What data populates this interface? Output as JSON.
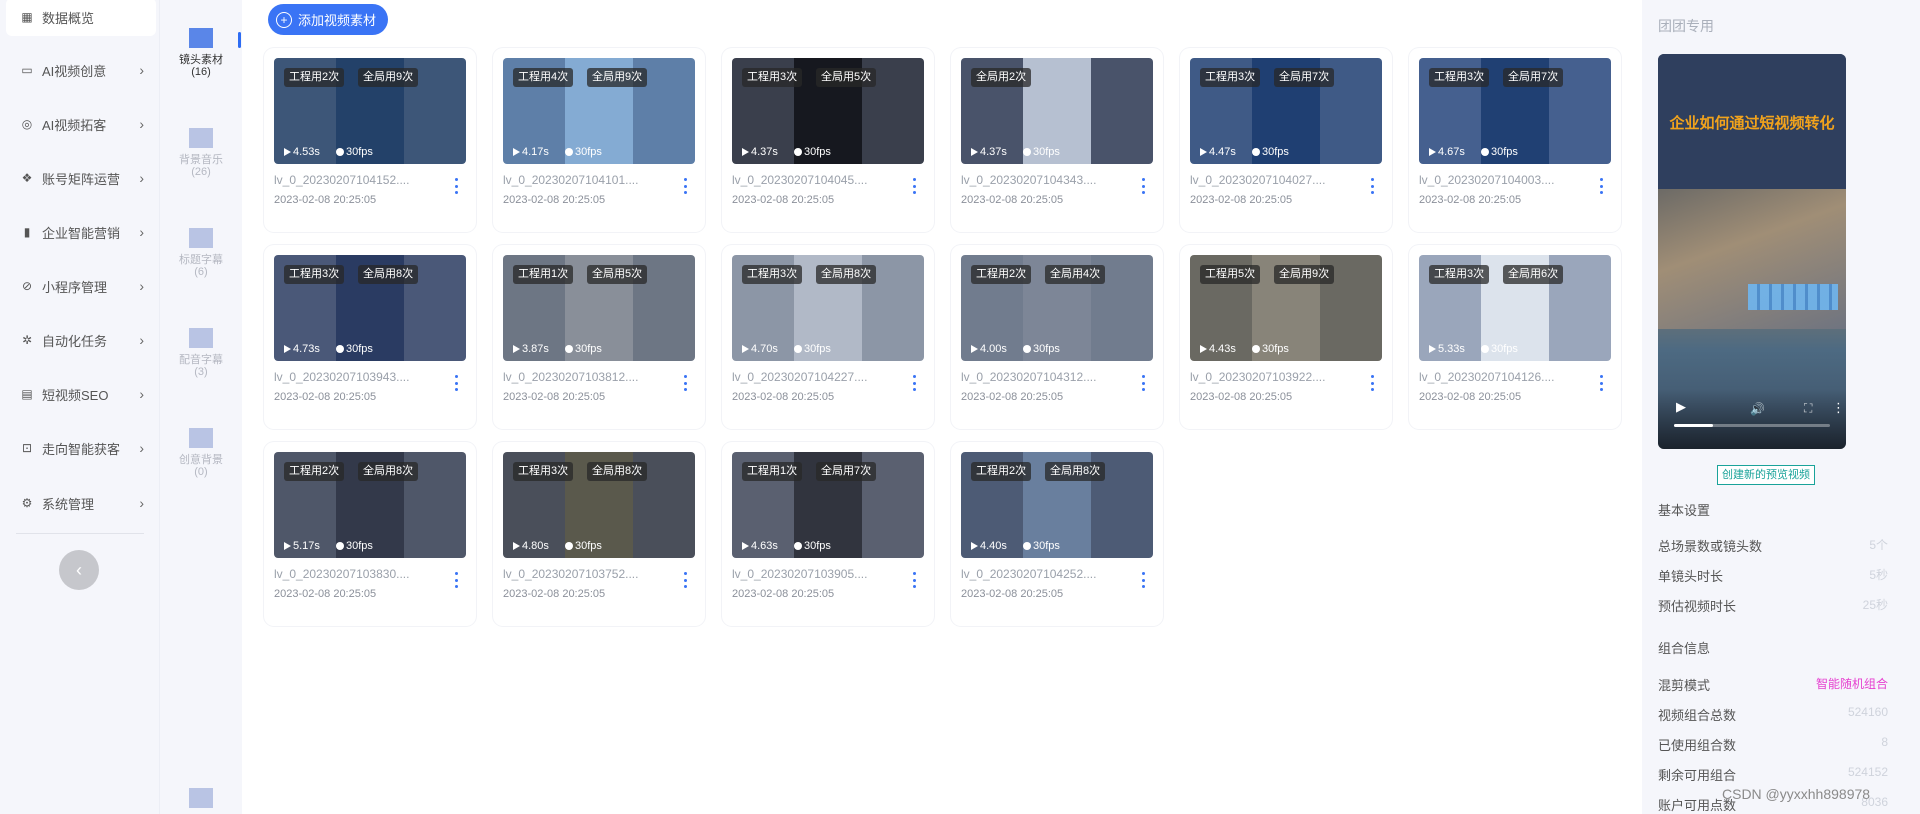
{
  "nav": {
    "items": [
      {
        "label": "数据概览",
        "icon": "dashboard-icon",
        "glyph": "▦",
        "arrow": ""
      },
      {
        "label": "AI视频创意",
        "icon": "image-icon",
        "glyph": "▭",
        "arrow": "›"
      },
      {
        "label": "AI视频拓客",
        "icon": "globe-icon",
        "glyph": "◎",
        "arrow": "›"
      },
      {
        "label": "账号矩阵运营",
        "icon": "matrix-icon",
        "glyph": "❖",
        "arrow": "›"
      },
      {
        "label": "企业智能营销",
        "icon": "bar-chart-icon",
        "glyph": "▮",
        "arrow": "›"
      },
      {
        "label": "小程序管理",
        "icon": "compass-icon",
        "glyph": "⊘",
        "arrow": "›"
      },
      {
        "label": "自动化任务",
        "icon": "cog-task-icon",
        "glyph": "✲",
        "arrow": "›"
      },
      {
        "label": "短视频SEO",
        "icon": "list-icon",
        "glyph": "▤",
        "arrow": "›"
      },
      {
        "label": "走向智能获客",
        "icon": "gift-icon",
        "glyph": "⊡",
        "arrow": "›"
      },
      {
        "label": "系统管理",
        "icon": "gear-icon",
        "glyph": "⚙",
        "arrow": "›"
      }
    ],
    "collapse_glyph": "‹"
  },
  "categories": [
    {
      "label": "镜头素材",
      "count": "(16)"
    },
    {
      "label": "背景音乐",
      "count": "(26)"
    },
    {
      "label": "标题字幕",
      "count": "(6)"
    },
    {
      "label": "配音字幕",
      "count": "(3)"
    },
    {
      "label": "创意背景",
      "count": "(0)"
    },
    {
      "label": "",
      "count": ""
    }
  ],
  "toolbar": {
    "add_label": "添加视频素材",
    "add_glyph": "+"
  },
  "videos": [
    {
      "engineer": "工程用2次",
      "global": "全局用9次",
      "duration": "4.53s",
      "fps": "30fps",
      "name": "lv_0_20230207104152....",
      "date": "2023-02-08 20:25:05",
      "bg": "#3d5678",
      "shot": "#1f3d66"
    },
    {
      "engineer": "工程用4次",
      "global": "全局用9次",
      "duration": "4.17s",
      "fps": "30fps",
      "name": "lv_0_20230207104101....",
      "date": "2023-02-08 20:25:05",
      "bg": "#5e7fa8",
      "shot": "#8bb3db"
    },
    {
      "engineer": "工程用3次",
      "global": "全局用5次",
      "duration": "4.37s",
      "fps": "30fps",
      "name": "lv_0_20230207104045....",
      "date": "2023-02-08 20:25:05",
      "bg": "#3a3f4c",
      "shot": "#111217"
    },
    {
      "engineer": "",
      "global": "全局用2次",
      "duration": "4.37s",
      "fps": "30fps",
      "name": "lv_0_20230207104343....",
      "date": "2023-02-08 20:25:05",
      "bg": "#49536a",
      "shot": "#c9d3e3"
    },
    {
      "engineer": "工程用3次",
      "global": "全局用7次",
      "duration": "4.47s",
      "fps": "30fps",
      "name": "lv_0_20230207104027....",
      "date": "2023-02-08 20:25:05",
      "bg": "#3f5a86",
      "shot": "#1a3b6e"
    },
    {
      "engineer": "工程用3次",
      "global": "全局用7次",
      "duration": "4.67s",
      "fps": "30fps",
      "name": "lv_0_20230207104003....",
      "date": "2023-02-08 20:25:05",
      "bg": "#45608f",
      "shot": "#1a3b6e"
    },
    {
      "engineer": "工程用3次",
      "global": "全局用8次",
      "duration": "4.73s",
      "fps": "30fps",
      "name": "lv_0_20230207103943....",
      "date": "2023-02-08 20:25:05",
      "bg": "#4a5878",
      "shot": "#24365e"
    },
    {
      "engineer": "工程用1次",
      "global": "全局用5次",
      "duration": "3.87s",
      "fps": "30fps",
      "name": "lv_0_20230207103812....",
      "date": "2023-02-08 20:25:05",
      "bg": "#6d7684",
      "shot": "#8e949c"
    },
    {
      "engineer": "工程用3次",
      "global": "全局用8次",
      "duration": "4.70s",
      "fps": "30fps",
      "name": "lv_0_20230207104227....",
      "date": "2023-02-08 20:25:05",
      "bg": "#8c96a6",
      "shot": "#b7c0cc"
    },
    {
      "engineer": "工程用2次",
      "global": "全局用4次",
      "duration": "4.00s",
      "fps": "30fps",
      "name": "lv_0_20230207104312....",
      "date": "2023-02-08 20:25:05",
      "bg": "#717c8e",
      "shot": "#7f8899"
    },
    {
      "engineer": "工程用5次",
      "global": "全局用9次",
      "duration": "4.43s",
      "fps": "30fps",
      "name": "lv_0_20230207103922....",
      "date": "2023-02-08 20:25:05",
      "bg": "#6a6962",
      "shot": "#8d8a7e"
    },
    {
      "engineer": "工程用3次",
      "global": "全局用6次",
      "duration": "5.33s",
      "fps": "30fps",
      "name": "lv_0_20230207104126....",
      "date": "2023-02-08 20:25:05",
      "bg": "#9aa6bb",
      "shot": "#e8edf4"
    },
    {
      "engineer": "工程用2次",
      "global": "全局用8次",
      "duration": "5.17s",
      "fps": "30fps",
      "name": "lv_0_20230207103830....",
      "date": "2023-02-08 20:25:05",
      "bg": "#4f5769",
      "shot": "#2e3445"
    },
    {
      "engineer": "工程用3次",
      "global": "全局用8次",
      "duration": "4.80s",
      "fps": "30fps",
      "name": "lv_0_20230207103752....",
      "date": "2023-02-08 20:25:05",
      "bg": "#4a4f5a",
      "shot": "#5d5a4a"
    },
    {
      "engineer": "工程用1次",
      "global": "全局用7次",
      "duration": "4.63s",
      "fps": "30fps",
      "name": "lv_0_20230207103905....",
      "date": "2023-02-08 20:25:05",
      "bg": "#5a6070",
      "shot": "#2a2d35"
    },
    {
      "engineer": "工程用2次",
      "global": "全局用8次",
      "duration": "4.40s",
      "fps": "30fps",
      "name": "lv_0_20230207104252....",
      "date": "2023-02-08 20:25:05",
      "bg": "#4d5b75",
      "shot": "#6e86a6"
    }
  ],
  "panel": {
    "title": "团团专用",
    "player": {
      "headline": "企业如何通过短视频转化",
      "play_glyph": "▶",
      "volume_glyph": "🔊",
      "fullscreen_glyph": "⛶",
      "more_glyph": "⋮",
      "progress": 0.25
    },
    "create_label": "创建新的预览视频",
    "basic_title": "基本设置",
    "basic": [
      {
        "label": "总场景数或镜头数",
        "value": "5个"
      },
      {
        "label": "单镜头时长",
        "value": "5秒"
      },
      {
        "label": "预估视频时长",
        "value": "25秒"
      }
    ],
    "combo_title": "组合信息",
    "combo": [
      {
        "label": "混剪模式",
        "value": "智能随机组合",
        "accent": true
      },
      {
        "label": "视频组合总数",
        "value": "524160",
        "accent": false
      },
      {
        "label": "已使用组合数",
        "value": "8",
        "accent": false
      },
      {
        "label": "剩余可用组合",
        "value": "524152",
        "accent": false
      },
      {
        "label": "账户可用点数",
        "value": "8036",
        "accent": false
      }
    ]
  },
  "watermark": "CSDN @yyxxhh898978",
  "colors": {
    "accent": "#3a74f5",
    "create": "#1aa39a",
    "pink": "#e63fd0",
    "folder": "#5a86e8",
    "folder_dim": "#b9c4e4"
  }
}
